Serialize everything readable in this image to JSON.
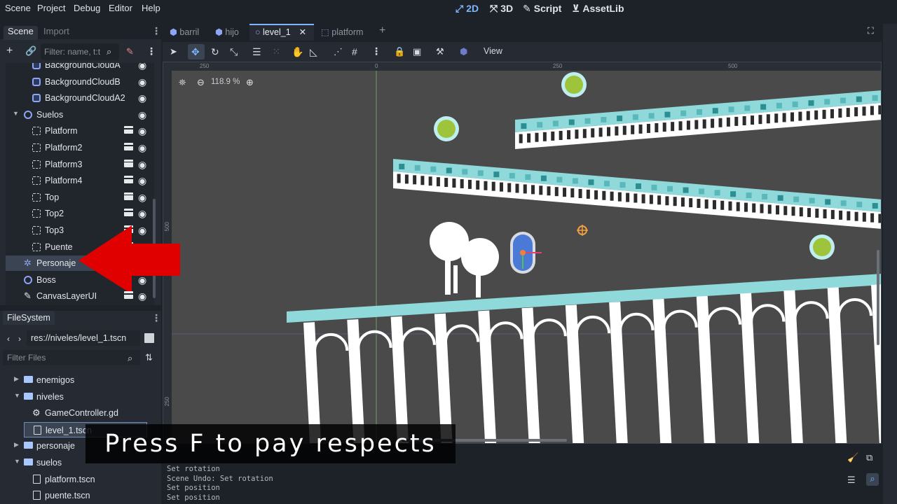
{
  "menu": {
    "items": [
      "Scene",
      "Project",
      "Debug",
      "Editor",
      "Help"
    ],
    "workspaces": [
      {
        "label": "2D",
        "icon": "2d-icon",
        "active": true
      },
      {
        "label": "3D",
        "icon": "3d-icon",
        "active": false
      },
      {
        "label": "Script",
        "icon": "script-icon",
        "active": false
      },
      {
        "label": "AssetLib",
        "icon": "assetlib-icon",
        "active": false
      }
    ]
  },
  "scene_dock": {
    "tabs": [
      "Scene",
      "Import"
    ],
    "filter_placeholder": "Filter: name, t:t",
    "tree": [
      {
        "label": "BackgroundCloudA",
        "icon": "sprite",
        "indent": 1
      },
      {
        "label": "BackgroundCloudB",
        "icon": "sprite",
        "indent": 1
      },
      {
        "label": "BackgroundCloudA2",
        "icon": "sprite",
        "indent": 1
      },
      {
        "label": "Suelos",
        "icon": "node",
        "indent": 0,
        "expanded": true
      },
      {
        "label": "Platform",
        "icon": "instance",
        "indent": 1,
        "scene": true
      },
      {
        "label": "Platform2",
        "icon": "instance",
        "indent": 1,
        "scene": true
      },
      {
        "label": "Platform3",
        "icon": "instance",
        "indent": 1,
        "scene": true
      },
      {
        "label": "Platform4",
        "icon": "instance",
        "indent": 1,
        "scene": true
      },
      {
        "label": "Top",
        "icon": "instance",
        "indent": 1,
        "scene": true
      },
      {
        "label": "Top2",
        "icon": "instance",
        "indent": 1,
        "scene": true
      },
      {
        "label": "Top3",
        "icon": "instance",
        "indent": 1,
        "scene": true
      },
      {
        "label": "Puente",
        "icon": "instance",
        "indent": 1,
        "scene": true
      },
      {
        "label": "Personaje",
        "icon": "character",
        "indent": 0,
        "selected": true
      },
      {
        "label": "Boss",
        "icon": "node",
        "indent": 0
      },
      {
        "label": "CanvasLayerUI",
        "icon": "canvas",
        "indent": 0,
        "scene": true
      }
    ]
  },
  "filesystem": {
    "title": "FileSystem",
    "path": "res://niveles/level_1.tscn",
    "filter_placeholder": "Filter Files",
    "items": [
      {
        "label": "enemigos",
        "type": "folder",
        "indent": 1
      },
      {
        "label": "niveles",
        "type": "folder",
        "indent": 1,
        "expanded": true
      },
      {
        "label": "GameController.gd",
        "type": "gear",
        "indent": 2
      },
      {
        "label": "level_1.tscn",
        "type": "scene",
        "indent": 2,
        "selected": true
      },
      {
        "label": "personaje",
        "type": "folder",
        "indent": 1
      },
      {
        "label": "suelos",
        "type": "folder",
        "indent": 1,
        "expanded": true
      },
      {
        "label": "platform.tscn",
        "type": "scene",
        "indent": 2
      },
      {
        "label": "puente.tscn",
        "type": "scene",
        "indent": 2
      }
    ]
  },
  "scene_tabs": [
    {
      "label": "barril",
      "active": false
    },
    {
      "label": "hijo",
      "active": false
    },
    {
      "label": "level_1",
      "active": true
    },
    {
      "label": "platform",
      "active": false
    }
  ],
  "viewport": {
    "zoom": "118.9 %",
    "view_menu": "View",
    "ruler_top": [
      "250",
      "0",
      "250",
      "500"
    ],
    "ruler_left": [
      "500",
      "250"
    ]
  },
  "output": {
    "lines": [
      "Set rotation",
      "Scene Undo: Set rotation",
      "Set position",
      "Set position"
    ]
  },
  "caption": "Press F to pay respects",
  "colors": {
    "accent": "#7fb5ff",
    "arrow": "#e00000",
    "platform_top": "#8fd9db",
    "coin": "#9dc43b"
  }
}
